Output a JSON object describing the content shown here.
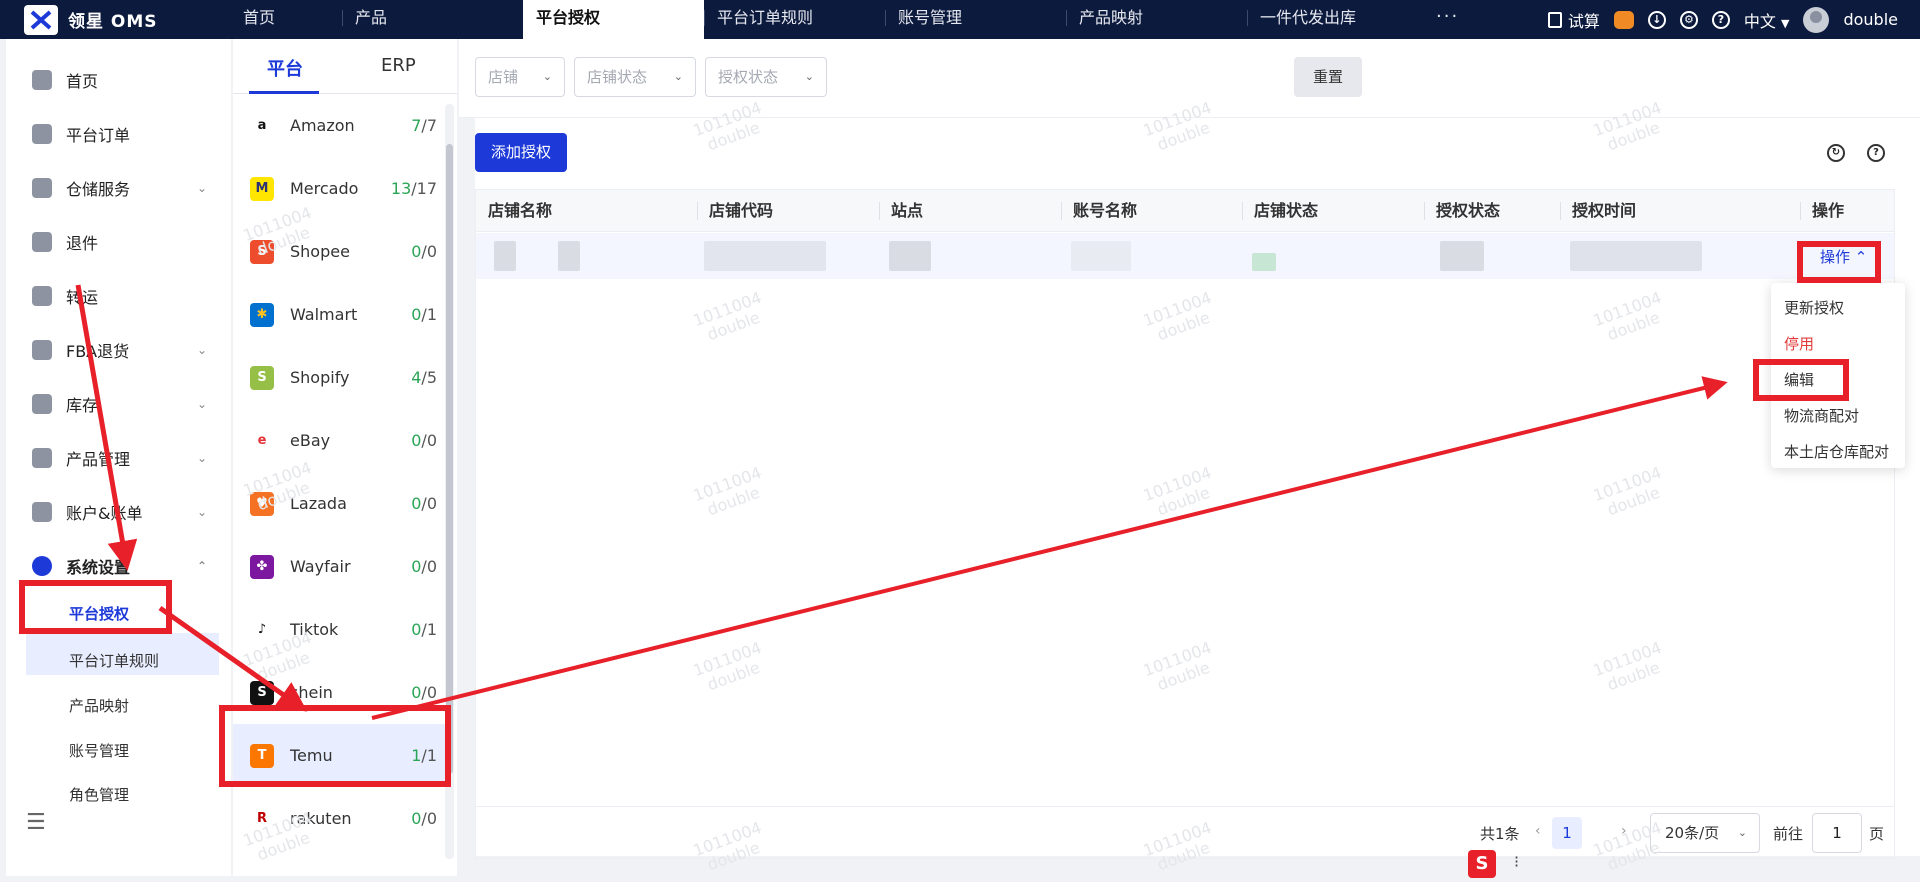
{
  "app": {
    "logo_text": "领星 OMS"
  },
  "top_tabs": [
    {
      "label": "首页"
    },
    {
      "label": "产品"
    },
    {
      "label": "平台授权"
    },
    {
      "label": "平台订单规则"
    },
    {
      "label": "账号管理"
    },
    {
      "label": "产品映射"
    },
    {
      "label": "一件代发出库"
    }
  ],
  "top_right": {
    "more": "···",
    "calc": "试算",
    "lang": "中文",
    "user": "double"
  },
  "sidebar": {
    "items": [
      {
        "label": "首页"
      },
      {
        "label": "平台订单"
      },
      {
        "label": "仓储服务"
      },
      {
        "label": "退件"
      },
      {
        "label": "转运"
      },
      {
        "label": "FBA退货"
      },
      {
        "label": "库存"
      },
      {
        "label": "产品管理"
      },
      {
        "label": "账户&账单"
      },
      {
        "label": "系统设置"
      }
    ],
    "sub_items": [
      {
        "label": "平台授权"
      },
      {
        "label": "平台订单规则"
      },
      {
        "label": "产品映射"
      },
      {
        "label": "账号管理"
      },
      {
        "label": "角色管理"
      }
    ]
  },
  "platform_tabs": {
    "platform": "平台",
    "erp": "ERP"
  },
  "platforms": [
    {
      "name": "Amazon",
      "active": "7",
      "total": "7",
      "color": "#ffffff",
      "fg": "#111111",
      "glyph": "a"
    },
    {
      "name": "Mercado",
      "active": "13",
      "total": "17",
      "color": "#ffe500",
      "fg": "#2d3277",
      "glyph": "M"
    },
    {
      "name": "Shopee",
      "active": "0",
      "total": "0",
      "color": "#ee4d2d",
      "fg": "#ffffff",
      "glyph": "S"
    },
    {
      "name": "Walmart",
      "active": "0",
      "total": "1",
      "color": "#0071ce",
      "fg": "#ffc220",
      "glyph": "✱"
    },
    {
      "name": "Shopify",
      "active": "4",
      "total": "5",
      "color": "#95bf47",
      "fg": "#ffffff",
      "glyph": "S"
    },
    {
      "name": "eBay",
      "active": "0",
      "total": "0",
      "color": "#ffffff",
      "fg": "#e53238",
      "glyph": "e"
    },
    {
      "name": "Lazada",
      "active": "0",
      "total": "0",
      "color": "#f57224",
      "fg": "#ffffff",
      "glyph": "♥"
    },
    {
      "name": "Wayfair",
      "active": "0",
      "total": "0",
      "color": "#7b189f",
      "fg": "#ffffff",
      "glyph": "✤"
    },
    {
      "name": "Tiktok",
      "active": "0",
      "total": "1",
      "color": "#ffffff",
      "fg": "#111111",
      "glyph": "♪"
    },
    {
      "name": "shein",
      "active": "0",
      "total": "0",
      "color": "#111111",
      "fg": "#ffffff",
      "glyph": "S"
    },
    {
      "name": "Temu",
      "active": "1",
      "total": "1",
      "color": "#fb7701",
      "fg": "#ffffff",
      "glyph": "T"
    },
    {
      "name": "rakuten",
      "active": "0",
      "total": "0",
      "color": "#ffffff",
      "fg": "#bf0000",
      "glyph": "R"
    }
  ],
  "filters": {
    "shop": "店铺",
    "shop_status": "店铺状态",
    "auth_status": "授权状态",
    "reset": "重置"
  },
  "actions": {
    "add_auth": "添加授权"
  },
  "table": {
    "headers": [
      "店铺名称",
      "店铺代码",
      "站点",
      "账号名称",
      "店铺状态",
      "授权状态",
      "授权时间",
      "操作"
    ],
    "row_action": "操作 ⌃"
  },
  "dropdown": [
    "更新授权",
    "停用",
    "编辑",
    "物流商配对",
    "本土店仓库配对"
  ],
  "pagination": {
    "total": "共1条",
    "page": "1",
    "page_size": "20条/页",
    "goto": "前往",
    "goto_value": "1",
    "page_unit": "页"
  },
  "watermark": {
    "line1": "1011004",
    "line2": "double"
  },
  "ime": {
    "badge": "S"
  },
  "colors": {
    "primary": "#1d3ad8",
    "topbar": "#0c1a3e",
    "annotation": "#e8202a",
    "success": "#2aa556",
    "danger": "#e23b3b"
  }
}
